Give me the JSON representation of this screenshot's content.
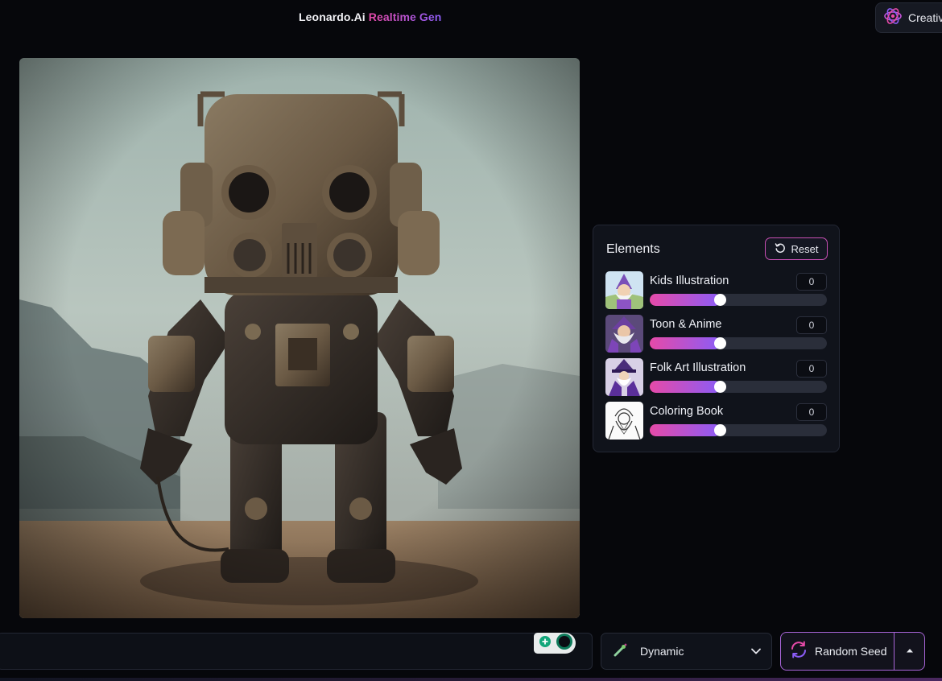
{
  "header": {
    "brand": "Leonardo.Ai",
    "product": "Realtime Gen",
    "creative_label": "Creativ"
  },
  "image": {
    "alt": "steampunk robot standing in desert"
  },
  "elements_panel": {
    "title": "Elements",
    "reset_label": "Reset",
    "items": [
      {
        "name": "Kids Illustration",
        "value": "0",
        "slider_fraction": 0.4
      },
      {
        "name": "Toon & Anime",
        "value": "0",
        "slider_fraction": 0.4
      },
      {
        "name": "Folk Art Illustration",
        "value": "0",
        "slider_fraction": 0.4
      },
      {
        "name": "Coloring Book",
        "value": "0",
        "slider_fraction": 0.4
      }
    ]
  },
  "bottom_bar": {
    "prompt_value": "",
    "style_label": "Dynamic",
    "seed_label": "Random Seed"
  },
  "colors": {
    "accent_pink": "#e64aa8",
    "accent_purple": "#8b5cf6",
    "background": "#06070b"
  },
  "icons": [
    "creative-logo-icon",
    "reset-icon",
    "wand-icon",
    "chevron-down-icon",
    "refresh-icon",
    "caret-up-icon",
    "prompt-enhance-icon"
  ]
}
